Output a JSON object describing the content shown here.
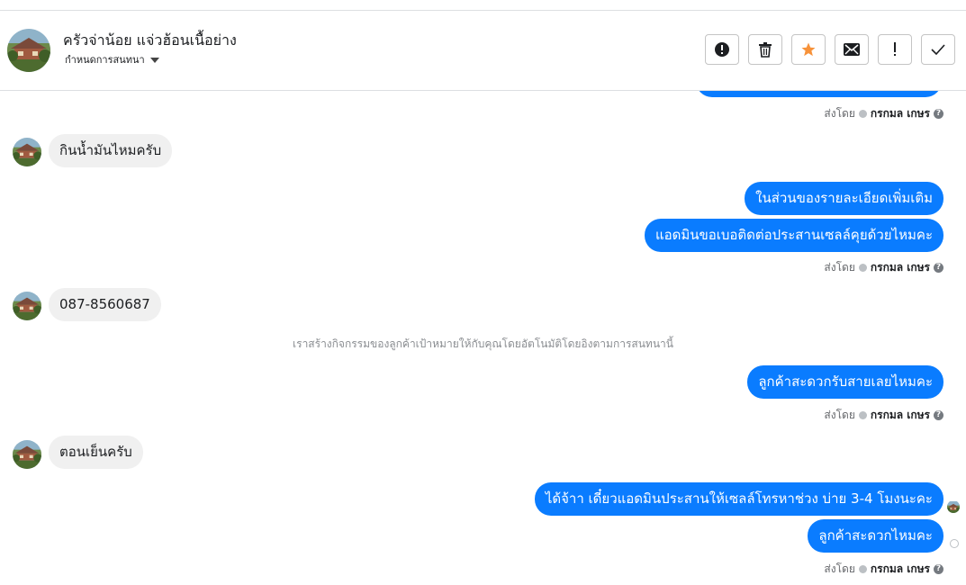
{
  "header": {
    "contact_name": "ครัวจ่าน้อย แจ่วฮ้อนเนื้อย่าง",
    "assign_label": "กำหนดการสนทนา",
    "toolbar_icons": [
      "alert-icon",
      "trash-icon",
      "star-icon",
      "mail-icon",
      "exclamation-icon",
      "check-icon"
    ],
    "star_color": "#f7923a"
  },
  "chat": {
    "meta_prefix": "ส่งโดย",
    "meta_sender": "กรกมล เกษร",
    "meta_help": "?",
    "incoming_1": "กินน้ำมันไหมครับ",
    "outgoing_1a": "ในส่วนของรายละเอียดเพิ่มเติม",
    "outgoing_1b": "แอดมินขอเบอติดต่อประสานเซลล์คุยด้วยไหมคะ",
    "incoming_2": "087-8560687",
    "system_note": "เราสร้างกิจกรรมของลูกค้าเป้าหมายให้กับคุณโดยอัตโนมัติโดยอิงตามการสนทนานี้",
    "outgoing_2": "ลูกค้าสะดวกรับสายเลยไหมคะ",
    "incoming_3": "ตอนเย็นครับ",
    "outgoing_3a": "ได้จ้าา เดี๋ยวแอดมินประสานให้เซลล์โทรหาช่วง บ่าย 3-4 โมงนะคะ",
    "outgoing_3b": "ลูกค้าสะดวกไหมคะ"
  },
  "colors": {
    "outgoing_bubble": "#0a7cff",
    "incoming_bubble": "#f0f0f0"
  }
}
